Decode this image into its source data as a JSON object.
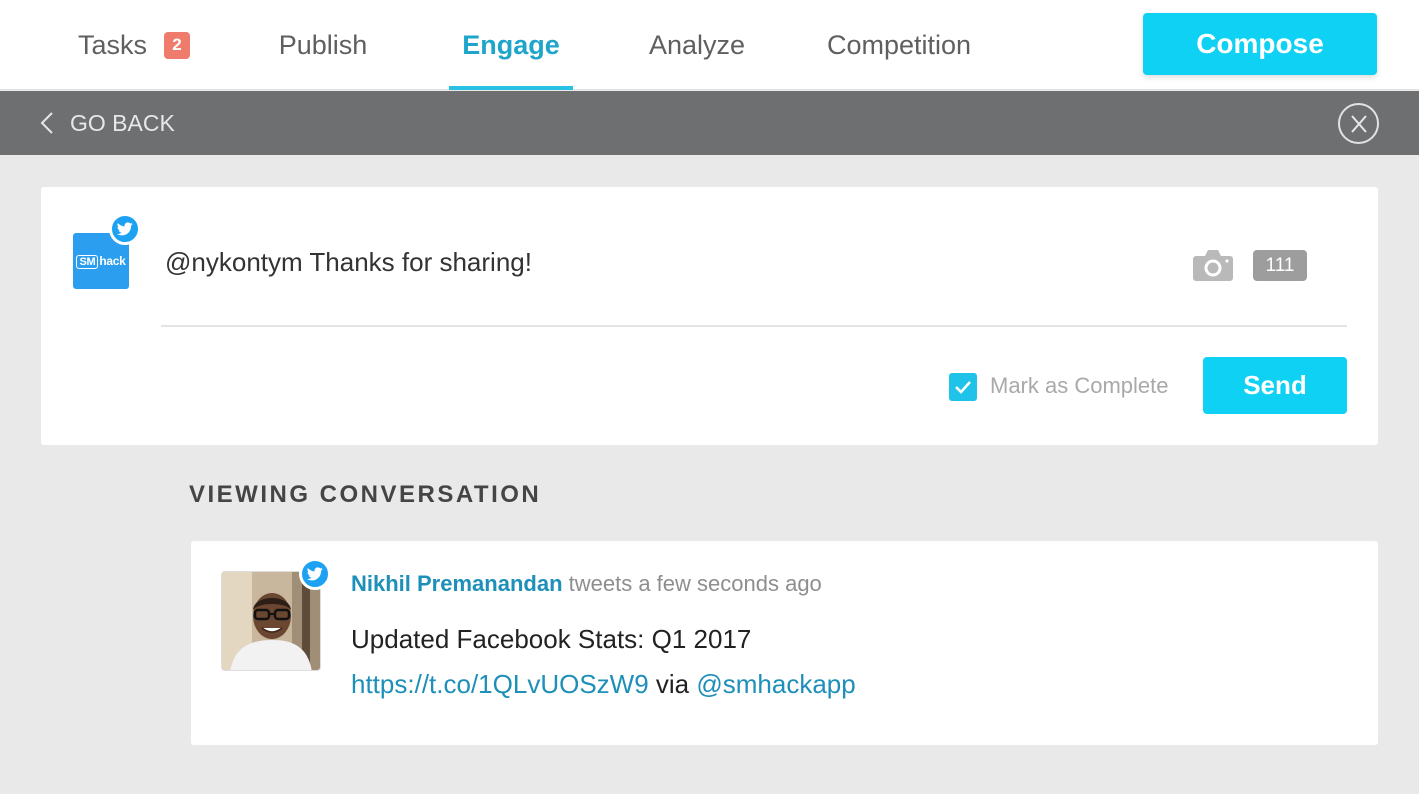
{
  "nav": {
    "tabs": [
      {
        "label": "Tasks",
        "badge": "2"
      },
      {
        "label": "Publish"
      },
      {
        "label": "Engage",
        "active": true
      },
      {
        "label": "Analyze"
      },
      {
        "label": "Competition"
      }
    ],
    "compose_label": "Compose"
  },
  "backbar": {
    "go_back_label": "GO BACK",
    "close_label": "X"
  },
  "reply": {
    "account_logo_sm": "SM",
    "account_logo_text": "hack",
    "text": "@nykontym Thanks for sharing!",
    "char_count": "111",
    "mark_complete_label": "Mark as Complete",
    "mark_complete_checked": true,
    "send_label": "Send"
  },
  "conversation": {
    "heading": "VIEWING CONVERSATION",
    "tweet": {
      "author": "Nikhil Premanandan",
      "meta": "tweets a few seconds ago",
      "line1": "Updated Facebook Stats: Q1 2017",
      "link": "https://t.co/1QLvUOSzW9",
      "via": "via",
      "mention": "@smhackapp"
    }
  },
  "colors": {
    "accent": "#0fd1f3",
    "active_tab": "#1ea5c9",
    "badge": "#ef7b6c",
    "backbar": "#6e6f71",
    "twitter": "#1da1f2",
    "link": "#1d8fb9"
  },
  "icons": [
    "chevron-left-icon",
    "close-icon",
    "twitter-icon",
    "camera-icon",
    "checkmark-icon"
  ]
}
